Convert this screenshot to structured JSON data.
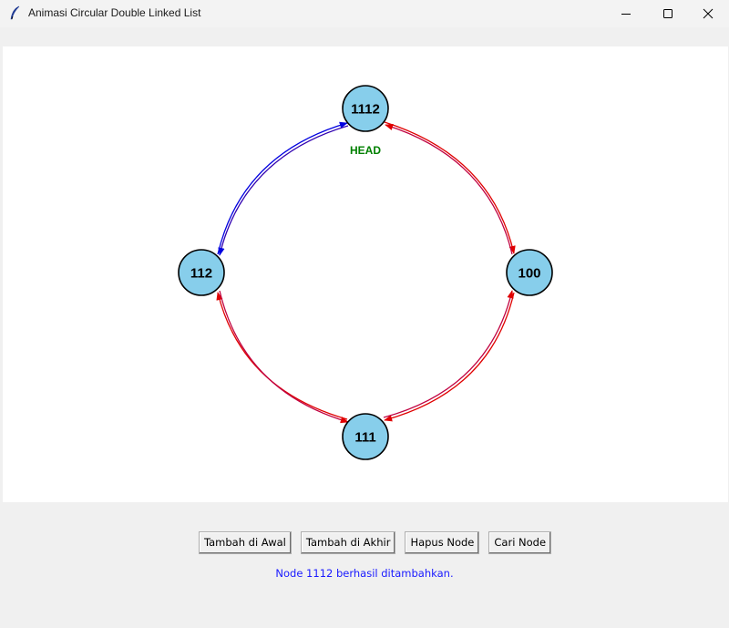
{
  "window": {
    "title": "Animasi Circular Double Linked List",
    "icon": "feather-icon",
    "controls": [
      "minimize-icon",
      "maximize-icon",
      "close-icon"
    ]
  },
  "diagram": {
    "head_label": "HEAD",
    "head_color": "#008000",
    "node_fill": "#87ceeb",
    "node_stroke": "#000000",
    "next_color": "#e00000",
    "prev_color": "#0000e0",
    "nodes": [
      {
        "value": "1112",
        "position": "top",
        "is_head": true
      },
      {
        "value": "100",
        "position": "right"
      },
      {
        "value": "111",
        "position": "bottom"
      },
      {
        "value": "112",
        "position": "left"
      }
    ],
    "links": [
      {
        "from": "1112",
        "to": "100",
        "color": "red"
      },
      {
        "from": "100",
        "to": "1112",
        "color": "red"
      },
      {
        "from": "100",
        "to": "111",
        "color": "red"
      },
      {
        "from": "111",
        "to": "100",
        "color": "red"
      },
      {
        "from": "111",
        "to": "112",
        "color": "red"
      },
      {
        "from": "112",
        "to": "111",
        "color": "red"
      },
      {
        "from": "112",
        "to": "1112",
        "color": "blue"
      },
      {
        "from": "1112",
        "to": "112",
        "color": "blue"
      }
    ]
  },
  "buttons": {
    "add_first": "Tambah di Awal",
    "add_last": "Tambah di Akhir",
    "delete": "Hapus Node",
    "search": "Cari Node"
  },
  "status": {
    "message": "Node 1112 berhasil ditambahkan.",
    "color": "#1a1aff"
  }
}
